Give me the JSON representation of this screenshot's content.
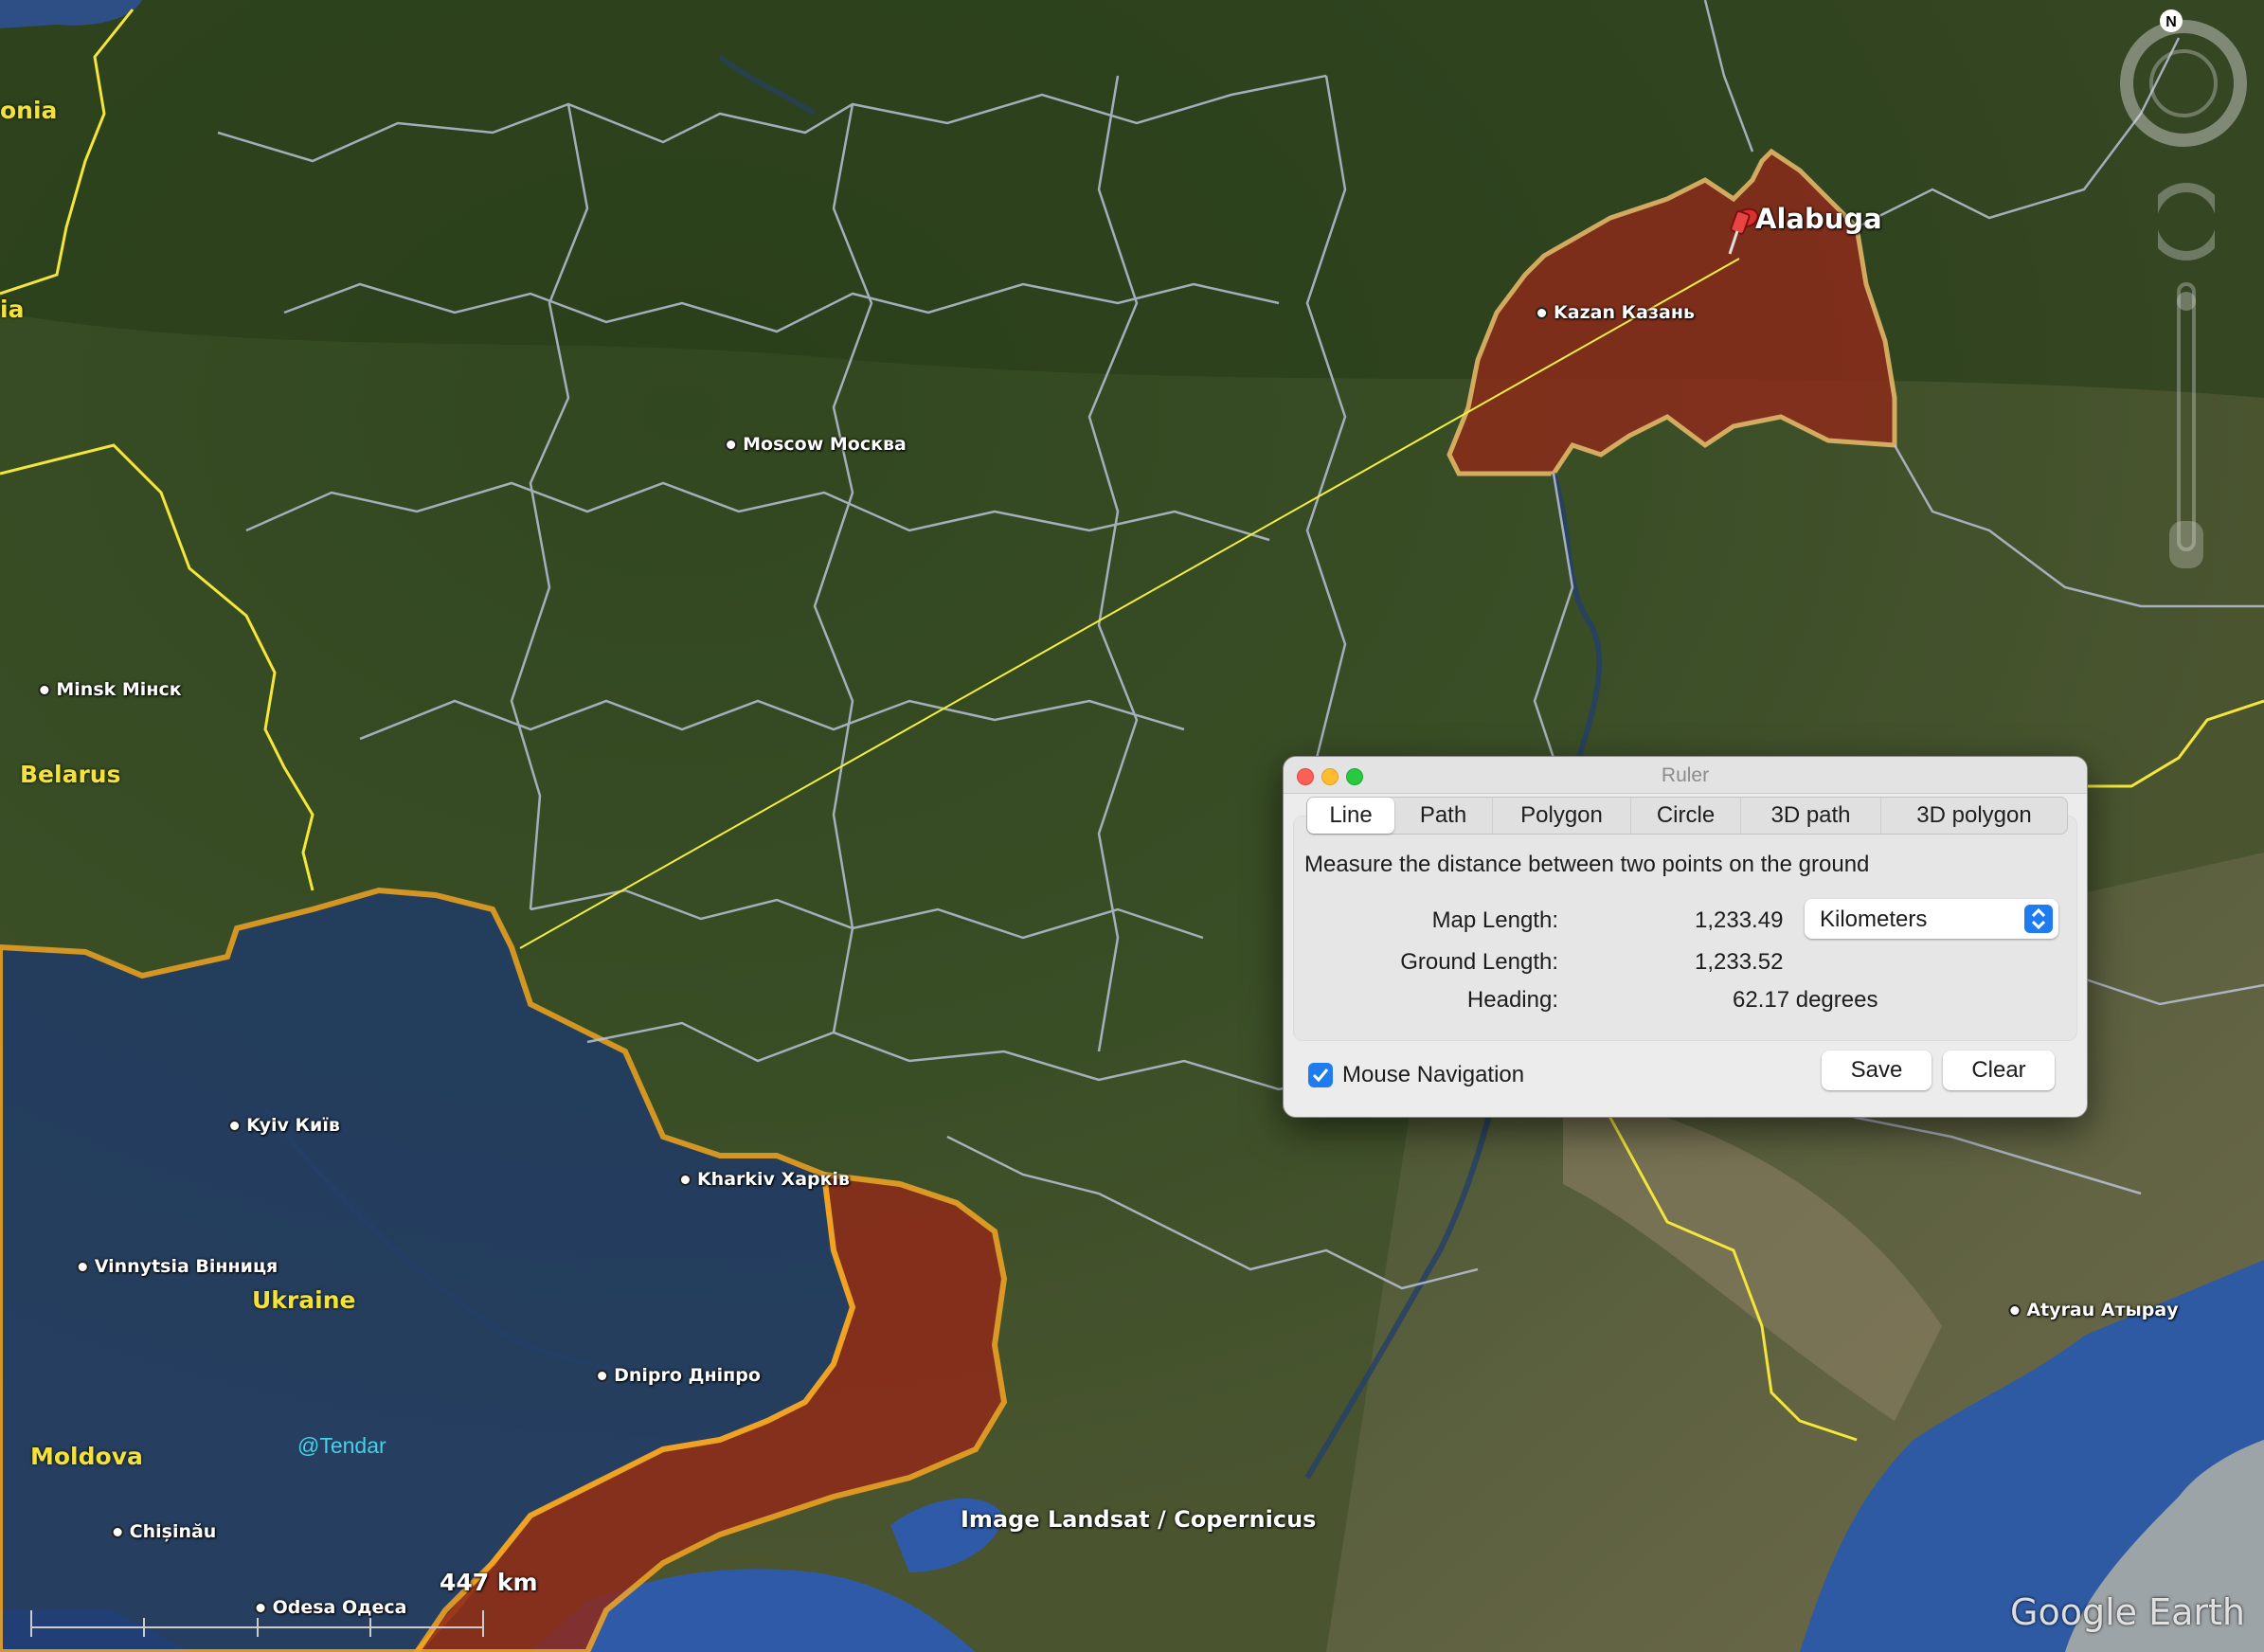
{
  "map": {
    "places": [
      {
        "name": "Kazan Казань"
      },
      {
        "name": "Moscow Москва"
      },
      {
        "name": "Minsk Мінск"
      },
      {
        "name": "Kyiv Київ"
      },
      {
        "name": "Kharkiv Харків"
      },
      {
        "name": "Vinnytsia Вінниця"
      },
      {
        "name": "Dnipro Дніпро"
      },
      {
        "name": "Chișinău"
      },
      {
        "name": "Odesa Одеса"
      },
      {
        "name": "Atyrau Атырау"
      }
    ],
    "countries": {
      "belarus": "Belarus",
      "ukraine": "Ukraine",
      "moldova": "Moldova",
      "estonia_partial": "onia",
      "latvia_partial": "ia"
    },
    "placemark": "Alabuga",
    "scale_label": "447 km",
    "imagery_credit": "Image Landsat / Copernicus",
    "watermark": "@Tendar",
    "logo": "Google Earth",
    "compass_label": "N",
    "colors": {
      "ruler_line": "#f4ef3f",
      "occupied_region": "#8f2a1a",
      "ukraine_overlay": "#1f3a6a",
      "border_highlight": "#f5a623"
    }
  },
  "ruler": {
    "title": "Ruler",
    "tabs": [
      "Line",
      "Path",
      "Polygon",
      "Circle",
      "3D path",
      "3D polygon"
    ],
    "active_tab": "Line",
    "description": "Measure the distance between two points on the ground",
    "map_length_label": "Map Length:",
    "map_length_value": "1,233.49",
    "unit": "Kilometers",
    "ground_length_label": "Ground Length:",
    "ground_length_value": "1,233.52",
    "heading_label": "Heading:",
    "heading_value": "62.17 degrees",
    "mouse_navigation_label": "Mouse Navigation",
    "mouse_navigation_checked": true,
    "save_label": "Save",
    "clear_label": "Clear"
  }
}
